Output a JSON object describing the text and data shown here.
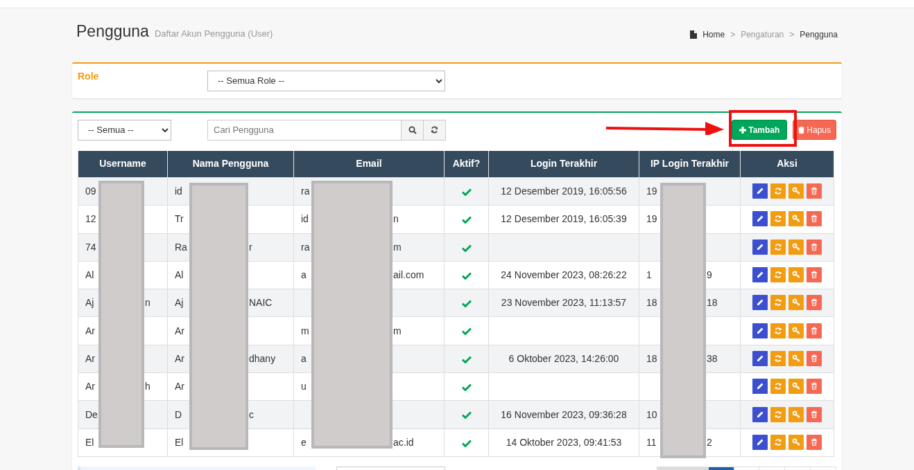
{
  "page": {
    "title": "Pengguna",
    "subtitle": "Daftar Akun Pengguna (User)"
  },
  "breadcrumb": [
    {
      "label": "Home",
      "kind": "home"
    },
    {
      "label": "Pengaturan",
      "kind": "link"
    },
    {
      "label": "Pengguna",
      "kind": "current"
    }
  ],
  "breadcrumb_separator": ">",
  "role_filter": {
    "label": "Role",
    "value": "-- Semua Role --"
  },
  "toolbar": {
    "status_select": "-- Semua --",
    "search": {
      "placeholder": "Cari Pengguna"
    },
    "buttons": [
      {
        "kind": "add",
        "label": "Tambah"
      },
      {
        "kind": "delete",
        "label": "Hapus"
      }
    ]
  },
  "table": {
    "columns": [
      "Username",
      "Nama Pengguna",
      "Email",
      "Aktif?",
      "Login Terakhir",
      "IP Login Terakhir",
      "Aksi"
    ],
    "rows": [
      {
        "username": {
          "start": "09"
        },
        "name": {
          "start": "id"
        },
        "email": {
          "start": "ra"
        },
        "active": true,
        "last_login": "12 Desember 2019, 16:05:56",
        "ip": {
          "start": "19"
        }
      },
      {
        "username": {
          "start": "12"
        },
        "name": {
          "start": "Tr"
        },
        "email": {
          "start": "id",
          "end": "n"
        },
        "active": true,
        "last_login": "12 Desember 2019, 16:05:39",
        "ip": {
          "start": "19"
        }
      },
      {
        "username": {
          "start": "74"
        },
        "name": {
          "start": "Ra",
          "end": "r"
        },
        "email": {
          "start": "ra",
          "end": "m"
        },
        "active": true,
        "ip": {}
      },
      {
        "username": {
          "start": "Al"
        },
        "name": {
          "start": "Al"
        },
        "email": {
          "start": "a",
          "end": "ail.com"
        },
        "active": true,
        "last_login": "24 November 2023, 08:26:22",
        "ip": {
          "start": "1",
          "end": "9"
        }
      },
      {
        "username": {
          "start": "Aj",
          "end": "n"
        },
        "name": {
          "start": "Aj",
          "end": "NAIC"
        },
        "email": {},
        "active": true,
        "last_login": "23 November 2023, 11:13:57",
        "ip": {
          "start": "18",
          "end": "18"
        }
      },
      {
        "username": {
          "start": "Ar"
        },
        "name": {
          "start": "Ar"
        },
        "email": {
          "start": "m",
          "end": "m"
        },
        "active": true,
        "ip": {}
      },
      {
        "username": {
          "start": "Ar"
        },
        "name": {
          "start": "Ar",
          "end": "dhany"
        },
        "email": {
          "start": "a"
        },
        "active": true,
        "last_login": "6 Oktober 2023, 14:26:00",
        "ip": {
          "start": "18",
          "end": "38"
        }
      },
      {
        "username": {
          "start": "Ar",
          "end": "h"
        },
        "name": {
          "start": "Ar"
        },
        "email": {
          "start": "u"
        },
        "active": true,
        "ip": {}
      },
      {
        "username": {
          "start": "De"
        },
        "name": {
          "start": "D",
          "end": "c"
        },
        "email": {},
        "active": true,
        "last_login": "16 November 2023, 09:36:28",
        "ip": {
          "start": "10"
        }
      },
      {
        "username": {
          "start": "El"
        },
        "name": {
          "start": "El"
        },
        "email": {
          "start": "e",
          "end": "ac.id"
        },
        "active": true,
        "last_login": "14 Oktober 2023, 09:41:53",
        "ip": {
          "start": "11",
          "end": "2"
        }
      }
    ]
  }
}
